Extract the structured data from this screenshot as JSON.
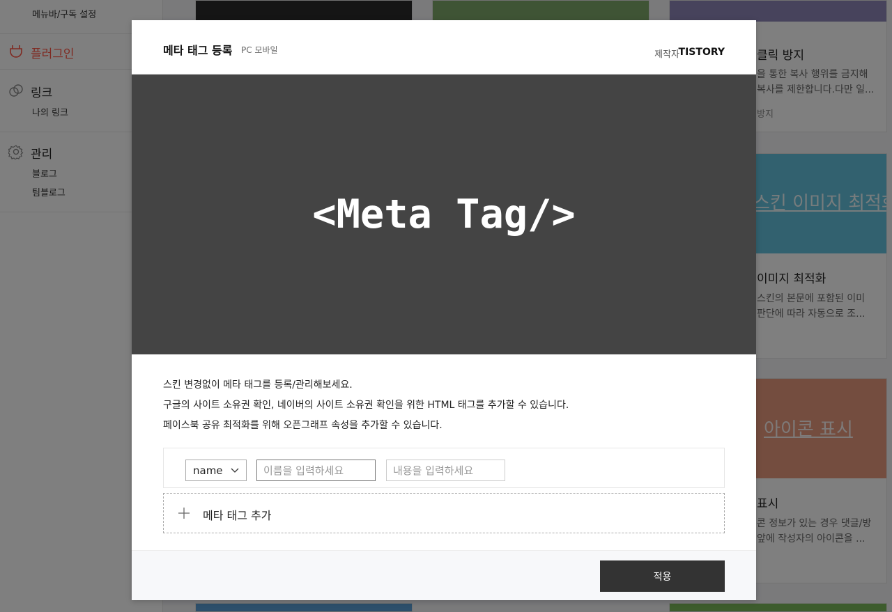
{
  "sidebar": {
    "menu_sub": "메뉴바/구독 설정",
    "plugin_label": "플러그인",
    "link_label": "링크",
    "my_link": "나의 링크",
    "manage_label": "관리",
    "blog": "블로그",
    "teamblog": "팀블로그",
    "accent_color": "#ff5544"
  },
  "background_cards": {
    "card1_title": "클릭 방지",
    "card1_desc1": "을 통한 복사 행위를 금지해",
    "card1_desc2": "복사를 제한합니다.다만 일...",
    "card1_tag": "방지",
    "card2_banner": "스킨 이미지 최적화",
    "card2_title": "이미지 최적화",
    "card2_desc1": "스킨의 본문에 포함된 이미",
    "card2_desc2": "판단에 따라 자동으로 조...",
    "card3_banner": "아이콘 표시",
    "card3_title": "표시",
    "card3_desc1": "콘 정보가 있는 경우 댓글/방",
    "card3_desc2": "앞에 작성자의 아이콘을 ..."
  },
  "modal": {
    "title": "메타 태그 등록",
    "platform": "PC 모바일",
    "maker_label": "제작자",
    "maker": "TISTORY",
    "hero_text": "<Meta Tag/>",
    "hero_bg": "#444444",
    "desc": [
      "스킨 변경없이 메타 태그를 등록/관리해보세요.",
      "구글의 사이트 소유권 확인, 네이버의 사이트 소유권 확인을 위한 HTML 태그를 추가할 수 있습니다.",
      "페이스북 공유 최적화를 위해 오픈그래프 속성을 추가할 수 있습니다."
    ],
    "row": {
      "select_value": "name",
      "name_placeholder": "이름을 입력하세요",
      "content_placeholder": "내용을 입력하세요"
    },
    "add_label": "메타 태그 추가",
    "apply_label": "적용"
  }
}
